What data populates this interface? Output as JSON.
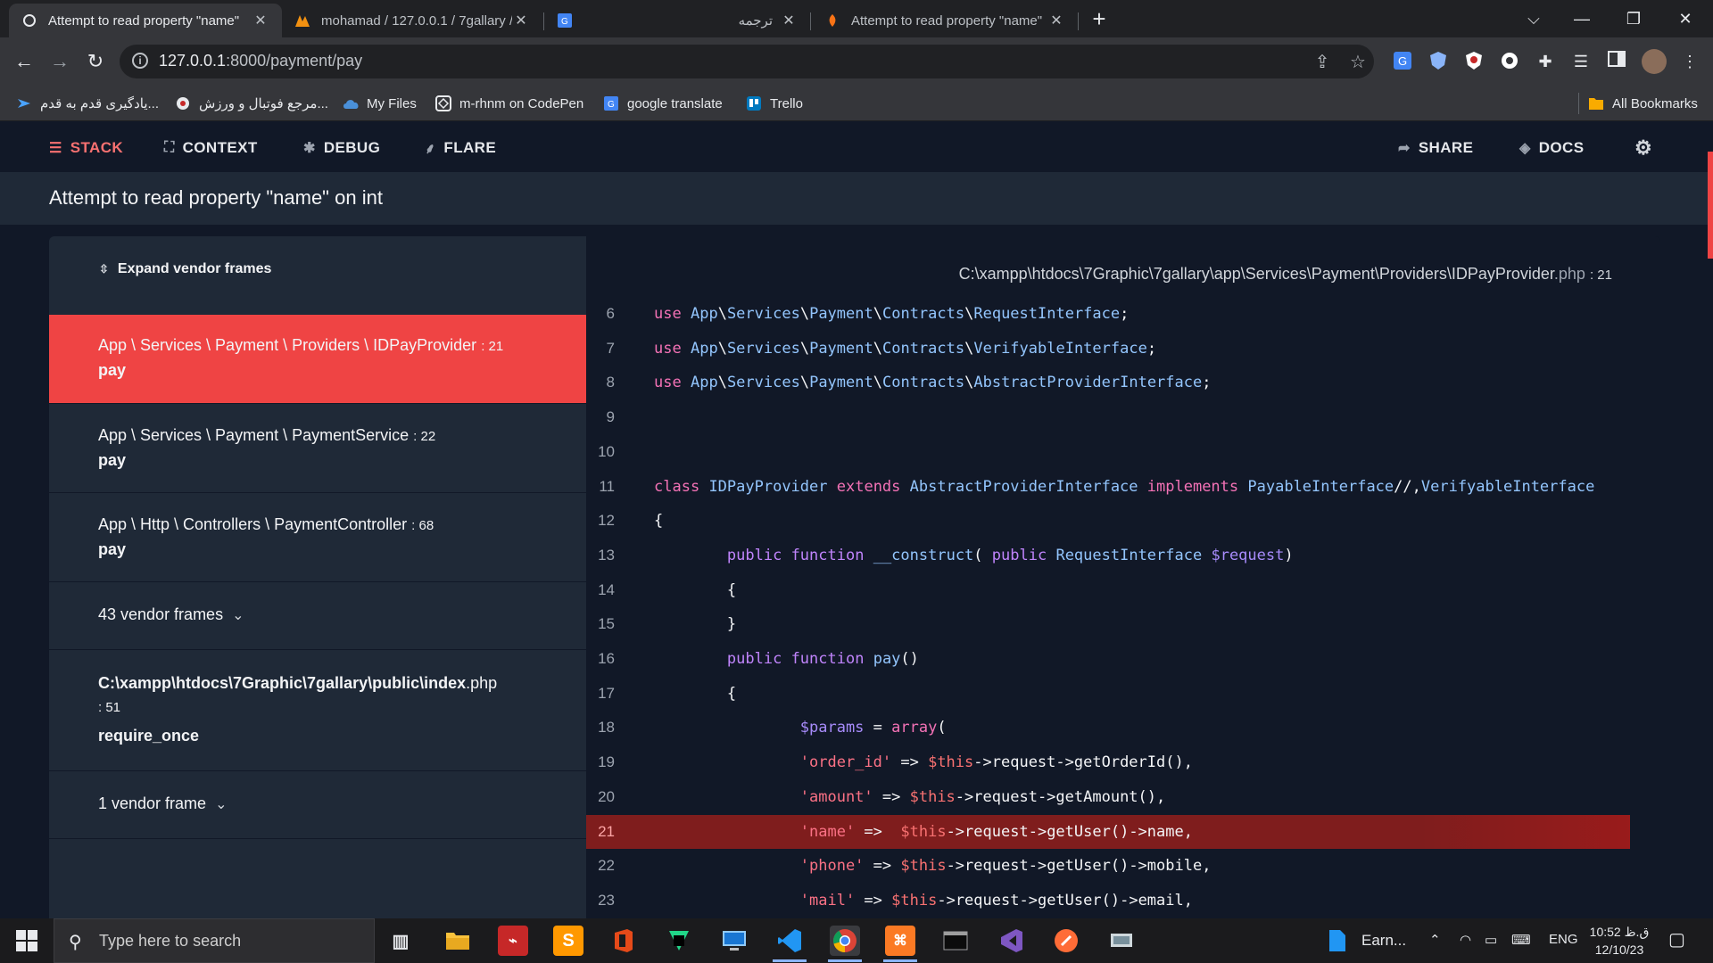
{
  "browser": {
    "tabs": [
      {
        "title": "Attempt to read property \"name\"",
        "close": "✕",
        "favicon": "ignition-icon"
      },
      {
        "title": "mohamad / 127.0.0.1 / 7gallary / ",
        "close": "✕",
        "favicon": "phpmyadmin-icon"
      },
      {
        "title": "ترجمه",
        "close": "✕",
        "favicon": "google-translate-icon"
      },
      {
        "title": "Attempt to read property \"name\"",
        "close": "✕",
        "favicon": "ignition-icon"
      }
    ],
    "new_tab": "+",
    "window_controls": {
      "menu": "⌵",
      "minimize": "—",
      "restore": "❐",
      "close": "✕"
    },
    "url_host": "127.0.0.1",
    "url_rest": ":8000/payment/pay",
    "bookmarks": [
      {
        "label": "یادگیری قدم به قدم...",
        "icon": "blue-arrow-icon"
      },
      {
        "label": "مرجع فوتبال و ورزش...",
        "icon": "football-icon"
      },
      {
        "label": "My Files",
        "icon": "cloud-icon"
      },
      {
        "label": "m-rhnm on CodePen",
        "icon": "codepen-icon"
      },
      {
        "label": "google translate",
        "icon": "google-translate-icon"
      },
      {
        "label": "Trello",
        "icon": "trello-icon"
      }
    ],
    "all_bookmarks": "All Bookmarks"
  },
  "ignition": {
    "nav": {
      "stack": "STACK",
      "context": "CONTEXT",
      "debug": "DEBUG",
      "flare": "FLARE",
      "share": "SHARE",
      "docs": "DOCS"
    },
    "error_message": "Attempt to read property \"name\" on int",
    "expand_vendor": "Expand vendor frames",
    "frames": [
      {
        "class": "App \\ Services \\ Payment \\ Providers \\ IDPayProvider",
        "line": ": 21",
        "method": "pay"
      },
      {
        "class": "App \\ Services \\ Payment \\ PaymentService",
        "line": ": 22",
        "method": "pay"
      },
      {
        "class": "App \\ Http \\ Controllers \\ PaymentController",
        "line": ": 68",
        "method": "pay"
      },
      {
        "vendor": "43 vendor frames"
      },
      {
        "file_bold": "C:\\xampp\\htdocs\\7Graphic\\7gallary\\public\\index",
        "file_ext": ".php",
        "line": ": 51",
        "method": "require_once"
      },
      {
        "vendor": "1 vendor frame"
      }
    ],
    "file_path": "C:\\xampp\\htdocs\\7Graphic\\7gallary\\app\\Services\\Payment\\Providers\\IDPayProvider",
    "file_ext": ".php",
    "file_line": ": 21",
    "highlight_line": 21,
    "code": [
      {
        "n": "6",
        "t": "use App\\Services\\Payment\\Contracts\\RequestInterface;"
      },
      {
        "n": "7",
        "t": "use App\\Services\\Payment\\Contracts\\VerifyableInterface;"
      },
      {
        "n": "8",
        "t": "use App\\Services\\Payment\\Contracts\\AbstractProviderInterface;"
      },
      {
        "n": "9",
        "t": ""
      },
      {
        "n": "10",
        "t": ""
      },
      {
        "n": "11",
        "t": "class IDPayProvider extends AbstractProviderInterface implements PayableInterface//,VerifyableInterface"
      },
      {
        "n": "12",
        "t": "{"
      },
      {
        "n": "13",
        "t": "        public function __construct( public RequestInterface $request)"
      },
      {
        "n": "14",
        "t": "        {"
      },
      {
        "n": "15",
        "t": "        }"
      },
      {
        "n": "16",
        "t": "        public function pay()"
      },
      {
        "n": "17",
        "t": "        {"
      },
      {
        "n": "18",
        "t": "                $params = array("
      },
      {
        "n": "19",
        "t": "                'order_id' => $this->request->getOrderId(),"
      },
      {
        "n": "20",
        "t": "                'amount' => $this->request->getAmount(),"
      },
      {
        "n": "21",
        "t": "                'name' =>  $this->request->getUser()->name,"
      },
      {
        "n": "22",
        "t": "                'phone' => $this->request->getUser()->mobile,"
      },
      {
        "n": "23",
        "t": "                'mail' => $this->request->getUser()->email,"
      }
    ]
  },
  "taskbar": {
    "search_placeholder": "Type here to search",
    "widget_label": "Earn...",
    "language": "ENG",
    "time": "10:52 ق.ظ",
    "date": "12/10/23",
    "apps": [
      "task-view-icon",
      "file-explorer-icon",
      "acrobat-icon",
      "sublime-text-icon",
      "office-icon",
      "pycharm-icon",
      "remote-desktop-icon",
      "vscode-icon",
      "chrome-icon",
      "xampp-icon",
      "terminal-icon",
      "visual-studio-icon",
      "postman-icon",
      "network-tool-icon"
    ]
  },
  "colors": {
    "accent": "#ef4444",
    "page_bg": "#111827",
    "panel_bg": "#1f2937",
    "highlight_line": "#7f1d1d"
  }
}
